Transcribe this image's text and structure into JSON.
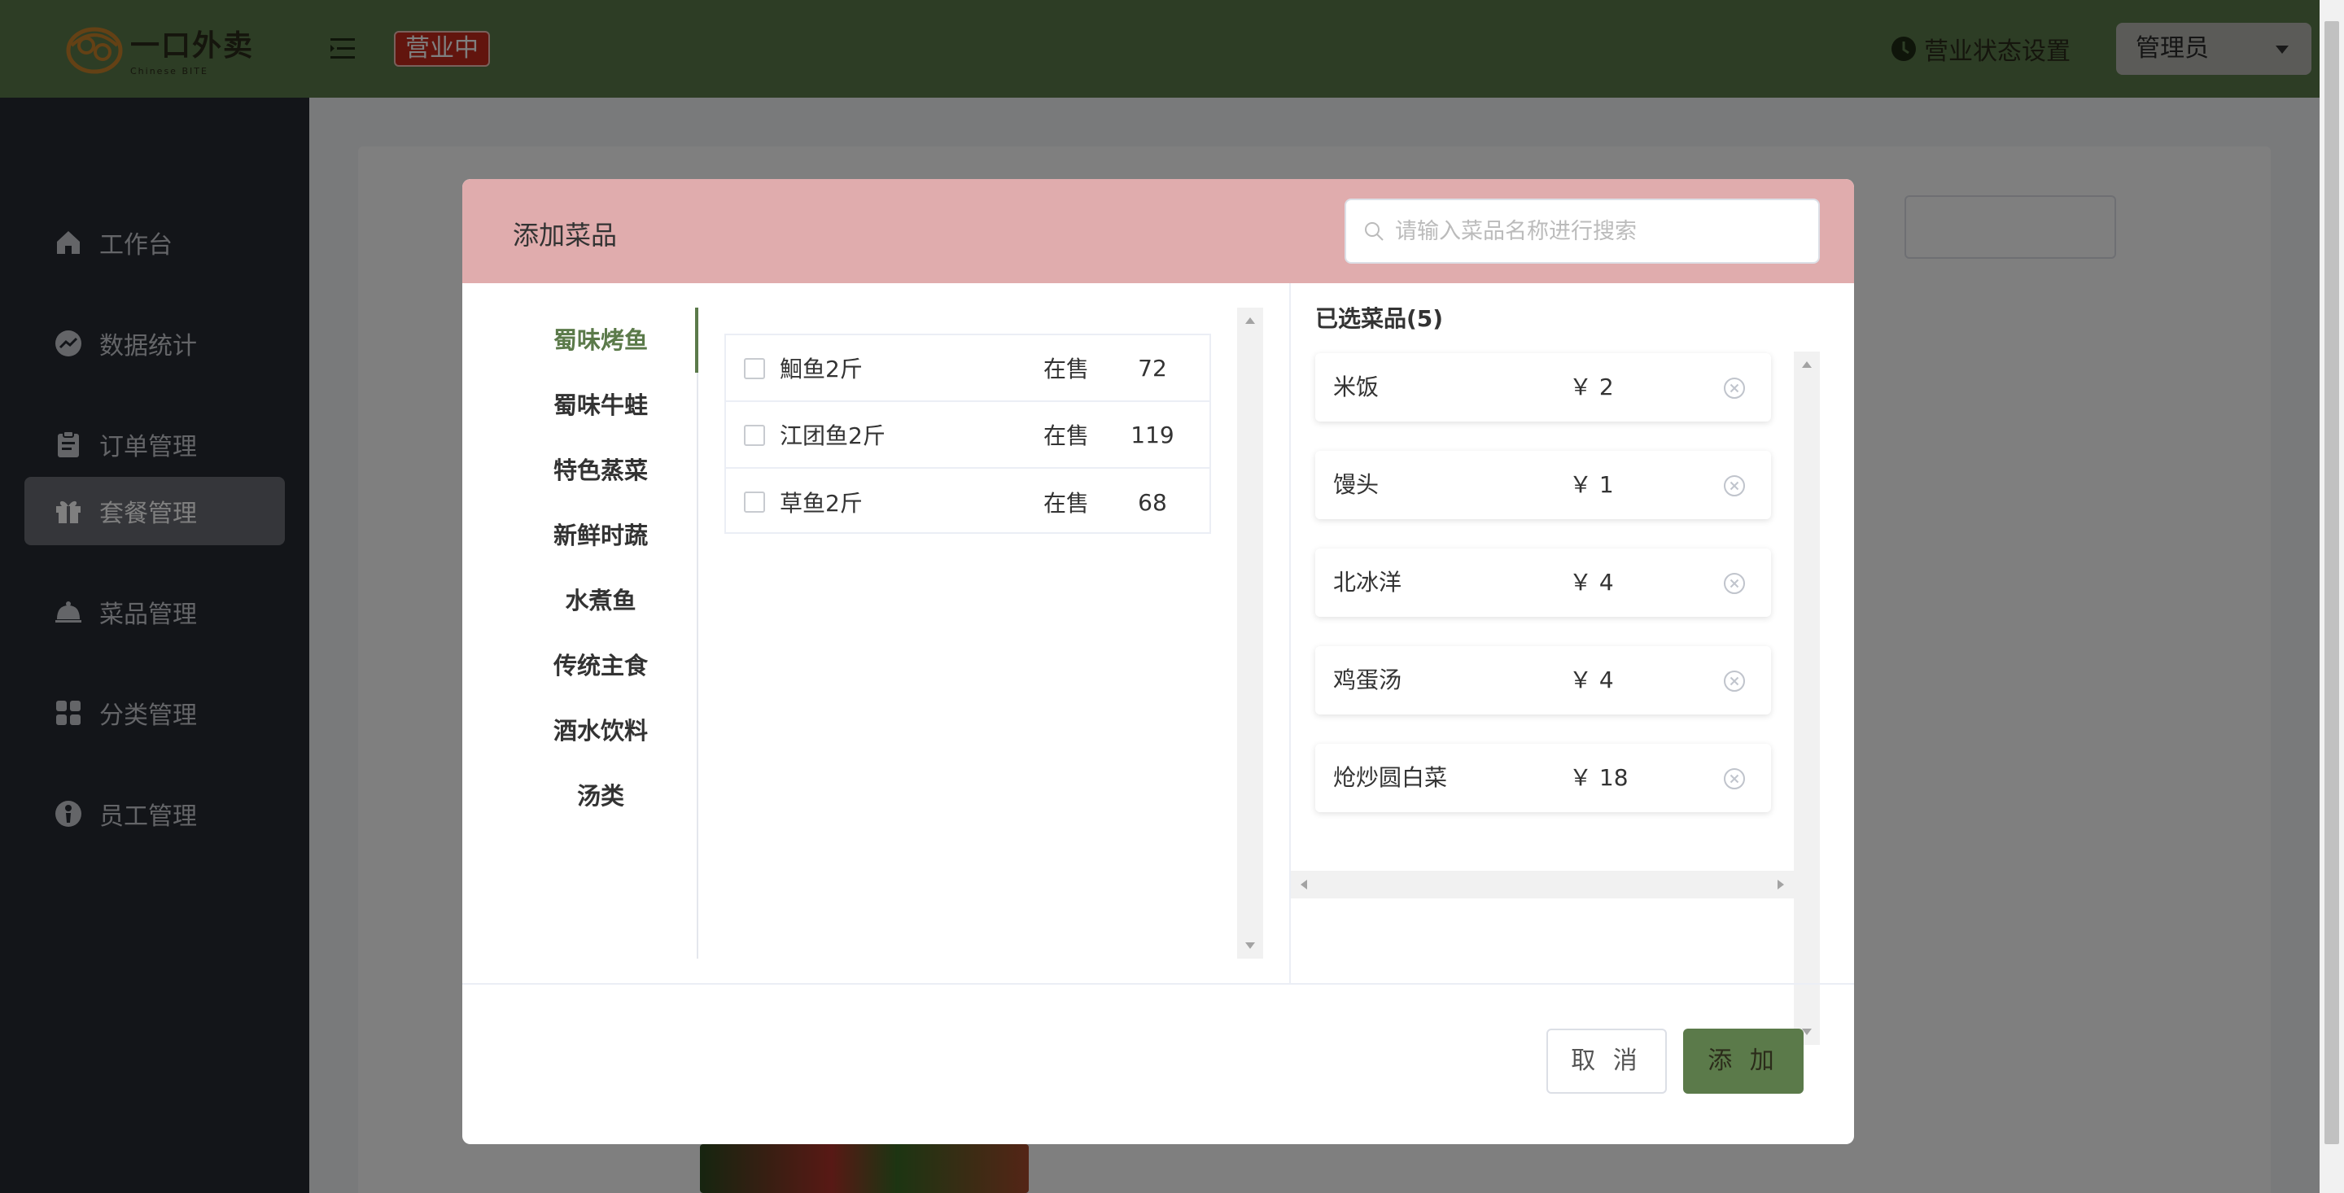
{
  "header": {
    "logo_cn": "一口外卖",
    "logo_en": "Chinese BITE",
    "status_tag": "营业中",
    "biz_setting": "营业状态设置",
    "admin": "管理员"
  },
  "sidebar": {
    "items": [
      {
        "label": "工作台",
        "icon": "home-icon"
      },
      {
        "label": "数据统计",
        "icon": "trend-icon"
      },
      {
        "label": "订单管理",
        "icon": "clipboard-icon"
      },
      {
        "label": "套餐管理",
        "icon": "gift-icon",
        "active": true
      },
      {
        "label": "菜品管理",
        "icon": "cloche-icon"
      },
      {
        "label": "分类管理",
        "icon": "grid-icon"
      },
      {
        "label": "员工管理",
        "icon": "employee-icon"
      }
    ]
  },
  "dialog": {
    "title": "添加菜品",
    "search_placeholder": "请输入菜品名称进行搜索",
    "categories": [
      "蜀味烤鱼",
      "蜀味牛蛙",
      "特色蒸菜",
      "新鲜时蔬",
      "水煮鱼",
      "传统主食",
      "酒水饮料",
      "汤类"
    ],
    "active_category": "蜀味烤鱼",
    "dishes": [
      {
        "name": "鮰鱼2斤",
        "status": "在售",
        "price": "72"
      },
      {
        "name": "江团鱼2斤",
        "status": "在售",
        "price": "119"
      },
      {
        "name": "草鱼2斤",
        "status": "在售",
        "price": "68"
      }
    ],
    "selected_title": "已选菜品(5)",
    "selected": [
      {
        "name": "米饭",
        "price": "￥ 2"
      },
      {
        "name": "馒头",
        "price": "￥ 1"
      },
      {
        "name": "北冰洋",
        "price": "￥ 4"
      },
      {
        "name": "鸡蛋汤",
        "price": "￥ 4"
      },
      {
        "name": "炝炒圆白菜",
        "price": "￥ 18"
      }
    ],
    "cancel_label": "取 消",
    "add_label": "添 加"
  },
  "colors": {
    "header_bg": "#5b7a4a",
    "sidebar_bg": "#262a33",
    "dialog_header_bg": "#e0acad",
    "accent": "#5b7a4a",
    "status_tag_bg": "#c42b1c"
  }
}
